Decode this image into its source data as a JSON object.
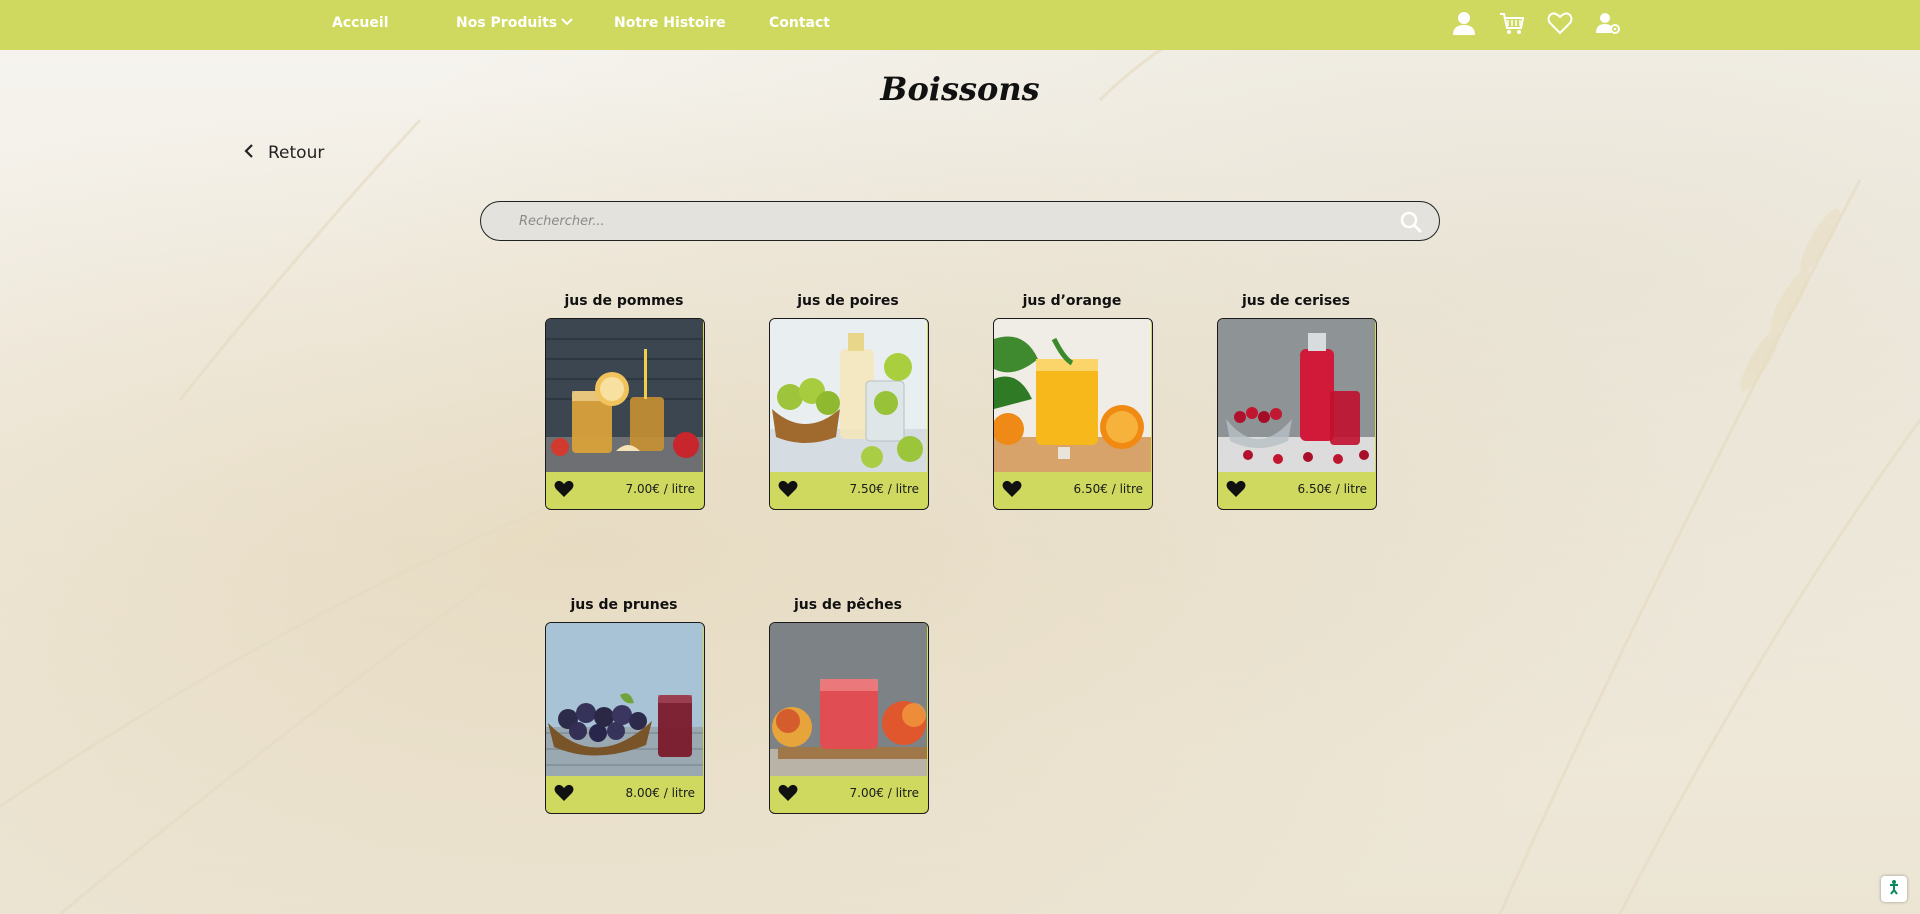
{
  "nav": {
    "links": [
      {
        "label": "Accueil"
      },
      {
        "label": "Nos Produits"
      },
      {
        "label": "Notre Histoire"
      },
      {
        "label": "Contact"
      }
    ],
    "icons": [
      "user-icon",
      "cart-icon",
      "heart-icon",
      "user-settings-icon"
    ]
  },
  "page": {
    "title": "Boissons",
    "back_label": "Retour"
  },
  "search": {
    "placeholder": "Rechercher...",
    "value": ""
  },
  "products": [
    {
      "name": "jus de pommes",
      "price": "7.00€ / litre",
      "image": "apple-juice"
    },
    {
      "name": "jus de poires",
      "price": "7.50€ / litre",
      "image": "pear-juice"
    },
    {
      "name": "jus d’orange",
      "price": "6.50€ / litre",
      "image": "orange-juice"
    },
    {
      "name": "jus de cerises",
      "price": "6.50€ / litre",
      "image": "cherry-juice"
    },
    {
      "name": "jus de prunes",
      "price": "8.00€ / litre",
      "image": "plum-juice"
    },
    {
      "name": "jus de pêches",
      "price": "7.00€ / litre",
      "image": "peach-juice"
    }
  ],
  "colors": {
    "brand": "#cfd95f",
    "text": "#111111"
  }
}
